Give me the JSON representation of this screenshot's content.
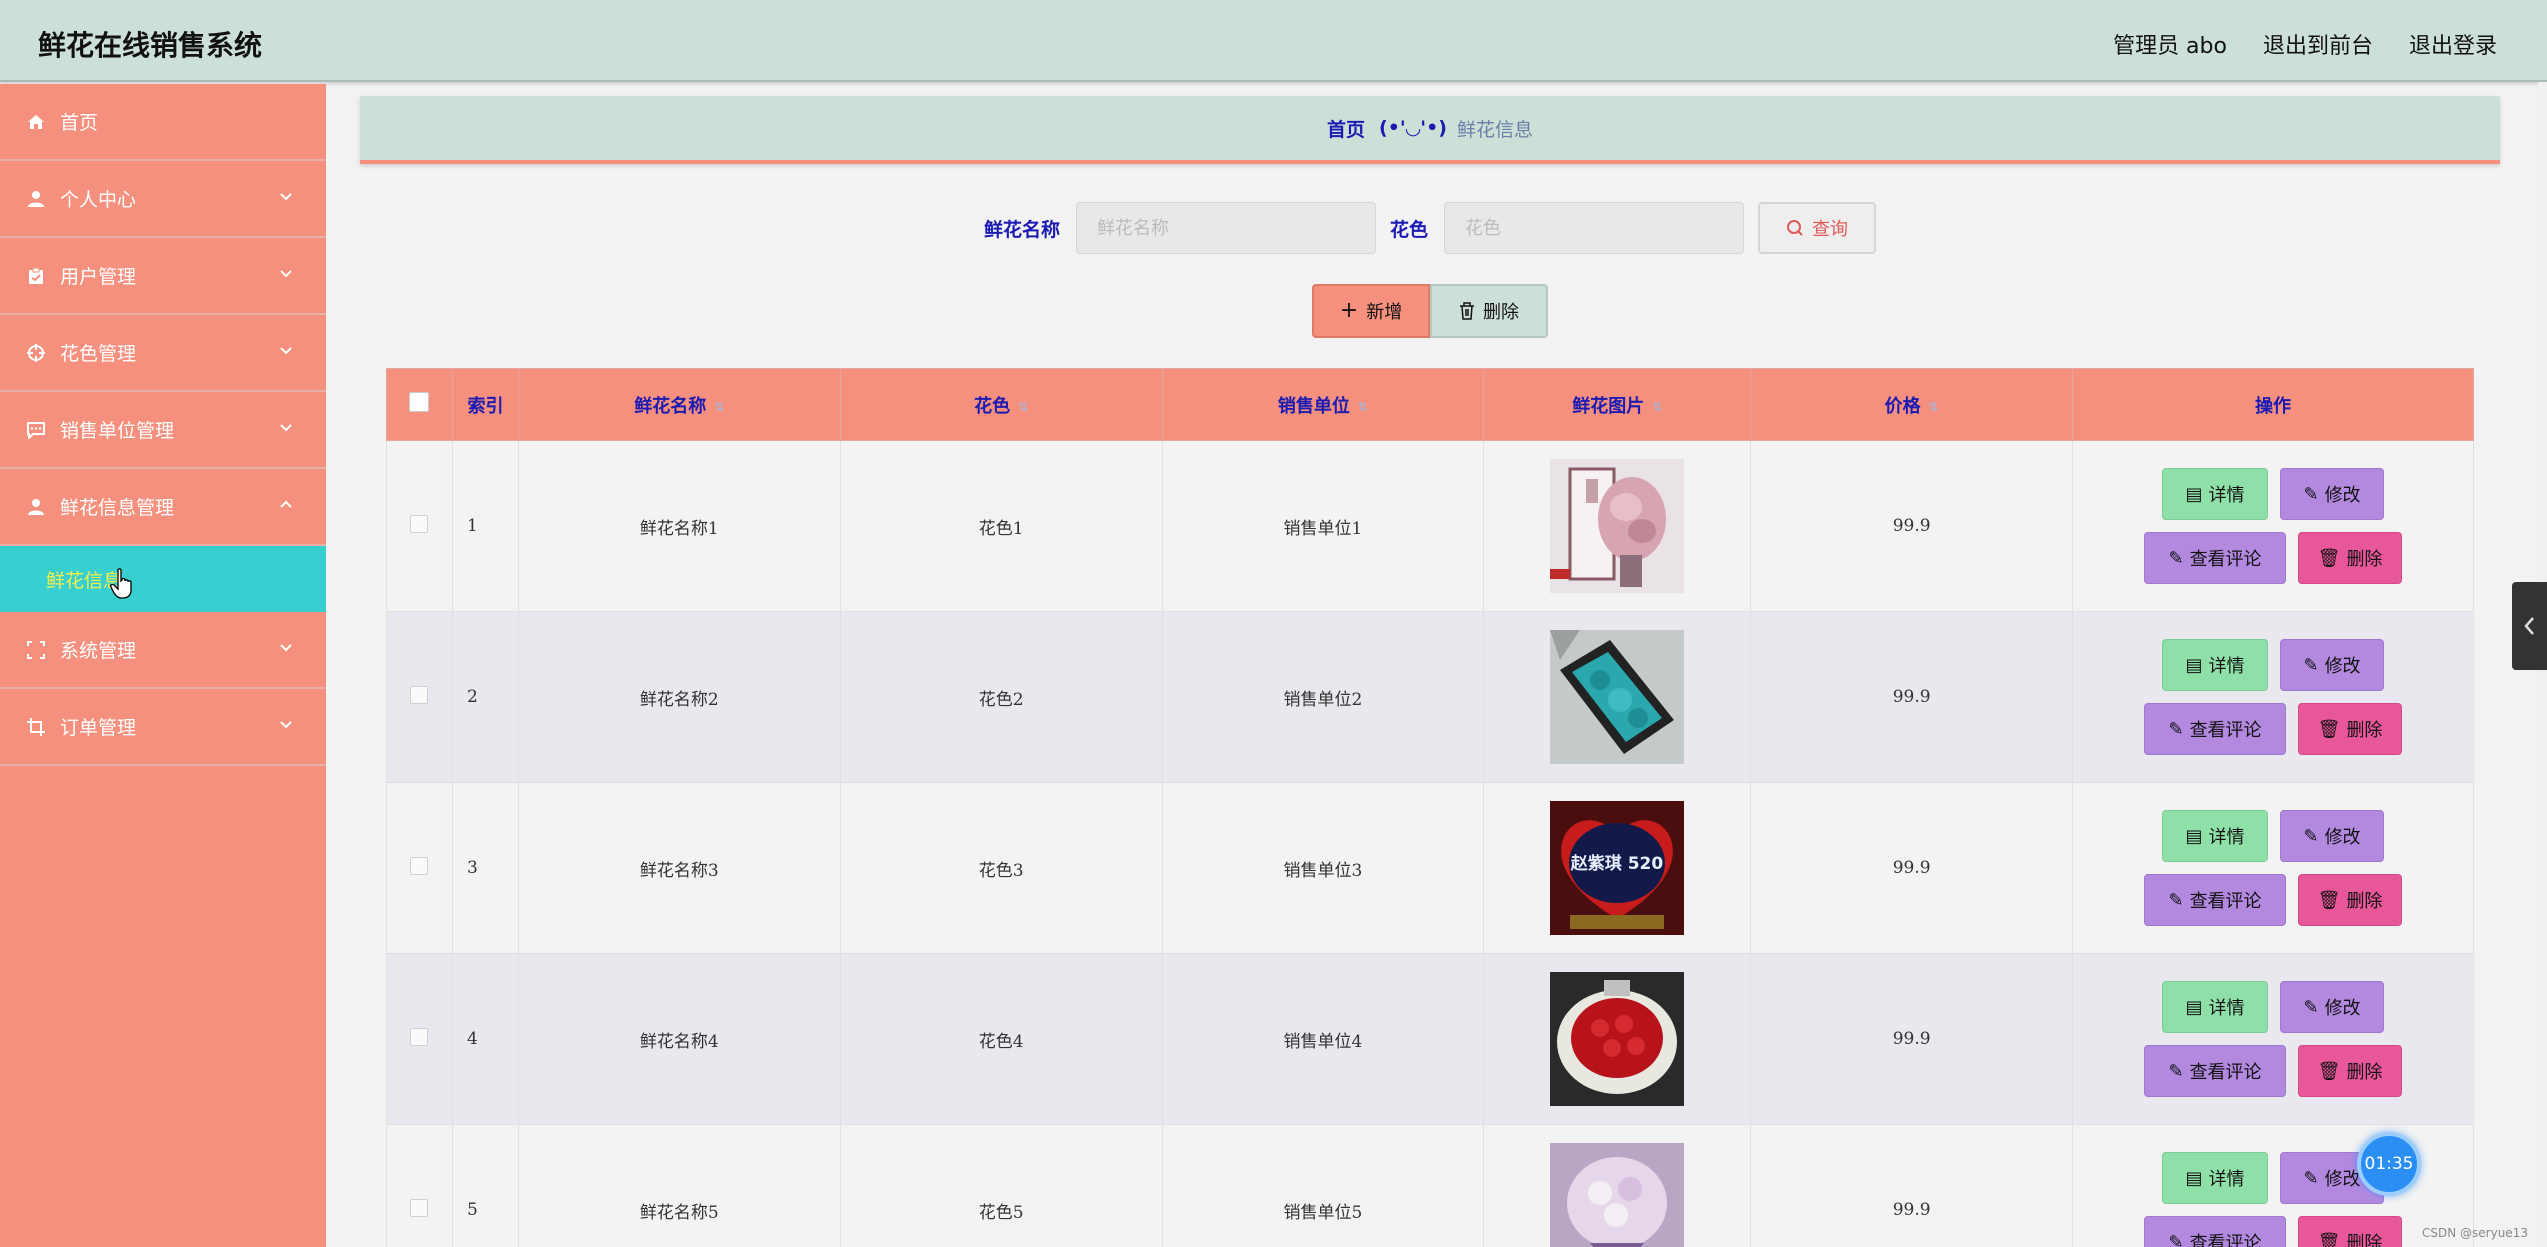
{
  "header": {
    "title": "鲜花在线销售系统",
    "admin": "管理员 abo",
    "to_front": "退出到前台",
    "logout": "退出登录"
  },
  "sidebar": {
    "items": [
      {
        "label": "首页",
        "icon": "home-icon"
      },
      {
        "label": "个人中心",
        "icon": "user-icon"
      },
      {
        "label": "用户管理",
        "icon": "clipboard-icon"
      },
      {
        "label": "花色管理",
        "icon": "crosshair-icon"
      },
      {
        "label": "销售单位管理",
        "icon": "chat-icon"
      },
      {
        "label": "鲜花信息管理",
        "icon": "user-icon"
      },
      {
        "label": "系统管理",
        "icon": "frame-icon"
      },
      {
        "label": "订单管理",
        "icon": "crop-icon"
      }
    ],
    "sub_item": "鲜花信息"
  },
  "breadcrumb": {
    "home": "首页",
    "sep": "(•'◡'•)",
    "current": "鲜花信息"
  },
  "search": {
    "name_label": "鲜花名称",
    "name_placeholder": "鲜花名称",
    "color_label": "花色",
    "color_placeholder": "花色",
    "query": "查询"
  },
  "actions": {
    "add": "新增",
    "delete": "删除"
  },
  "table": {
    "headers": {
      "index": "索引",
      "name": "鲜花名称",
      "color": "花色",
      "unit": "销售单位",
      "image": "鲜花图片",
      "price": "价格",
      "ops": "操作"
    },
    "rows": [
      {
        "index": "1",
        "name": "鲜花名称1",
        "color": "花色1",
        "unit": "销售单位1",
        "price": "99.9"
      },
      {
        "index": "2",
        "name": "鲜花名称2",
        "color": "花色2",
        "unit": "销售单位2",
        "price": "99.9"
      },
      {
        "index": "3",
        "name": "鲜花名称3",
        "color": "花色3",
        "unit": "销售单位3",
        "price": "99.9"
      },
      {
        "index": "4",
        "name": "鲜花名称4",
        "color": "花色4",
        "unit": "销售单位4",
        "price": "99.9"
      },
      {
        "index": "5",
        "name": "鲜花名称5",
        "color": "花色5",
        "unit": "销售单位5",
        "price": "99.9"
      }
    ],
    "row_buttons": {
      "detail": "详情",
      "edit": "修改",
      "comment": "查看评论",
      "delete": "删除"
    },
    "image3_text": "赵紫琪 520"
  },
  "overlay": {
    "timer": "01:35",
    "watermark": "CSDN @seryue13"
  },
  "colors": {
    "header_bg": "#cde0d8",
    "sidebar_bg": "#f4907d",
    "active_sub_bg": "#38cfd0",
    "link_blue": "#1b1bb3"
  }
}
